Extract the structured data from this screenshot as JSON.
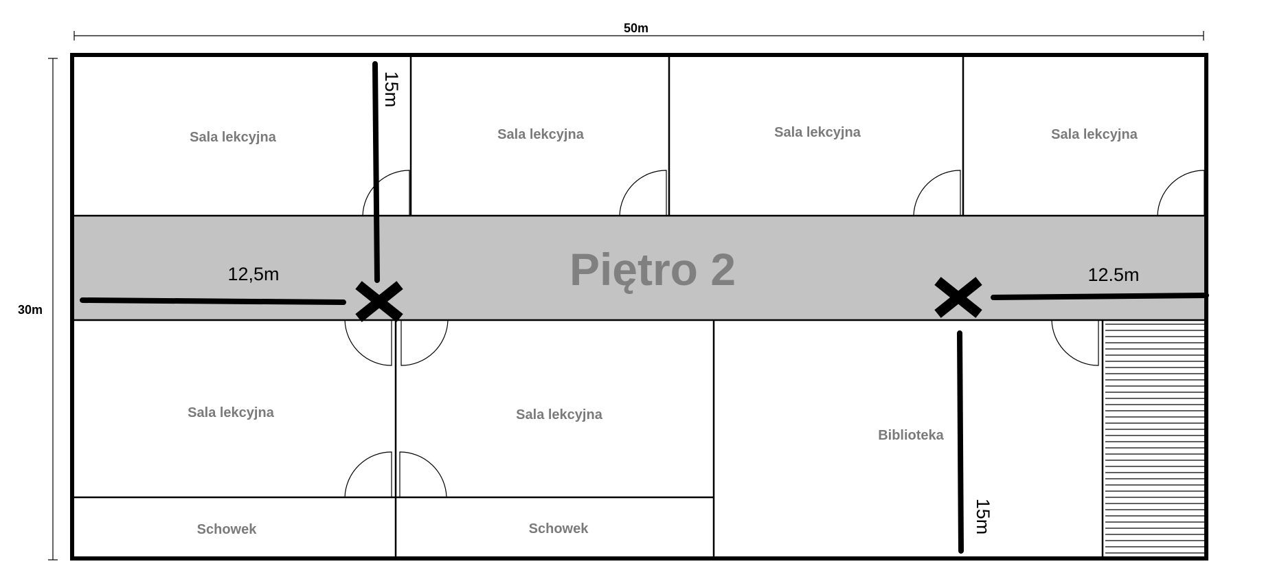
{
  "dimensions": {
    "width_label": "50m",
    "height_label": "30m"
  },
  "floor_title": "Piętro 2",
  "rooms_top": [
    "Sala lekcyjna",
    "Sala lekcyjna",
    "Sala lekcyjna",
    "Sala lekcyjna"
  ],
  "rooms_bottom": [
    "Sala lekcyjna",
    "Sala lekcyjna",
    "Biblioteka"
  ],
  "storage_rooms": [
    "Schowek",
    "Schowek"
  ],
  "measurements": {
    "left_horizontal": "12,5m",
    "right_horizontal": "12.5m",
    "left_vertical": "15m",
    "right_vertical": "15m"
  },
  "colors": {
    "corridor": "#c3c3c3",
    "room_text": "#7a7a7a",
    "title_text": "#808080",
    "lines": "#000000"
  }
}
